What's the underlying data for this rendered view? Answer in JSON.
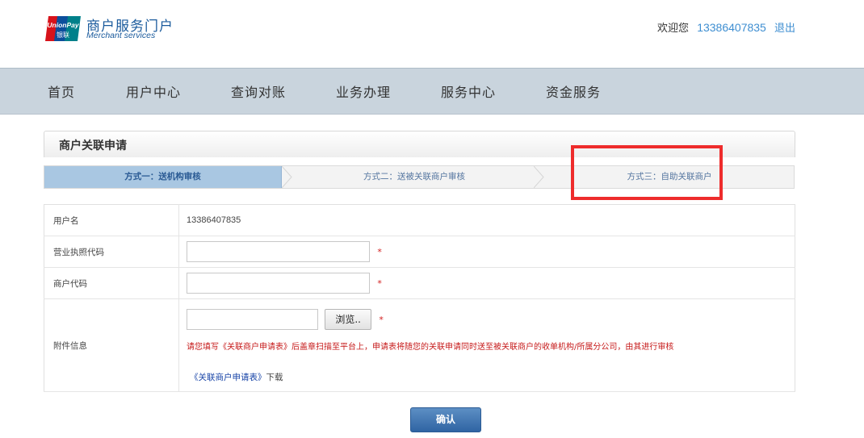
{
  "header": {
    "logo_brand_en": "UnionPay",
    "logo_brand_cn": "银联",
    "logo_title": "商户服务门户",
    "logo_subtitle": "Merchant services",
    "welcome_text": "欢迎您",
    "user_phone": "13386407835",
    "logout_label": "退出"
  },
  "nav": {
    "items": [
      {
        "label": "首页"
      },
      {
        "label": "用户中心"
      },
      {
        "label": "查询对账"
      },
      {
        "label": "业务办理"
      },
      {
        "label": "服务中心"
      },
      {
        "label": "资金服务"
      }
    ]
  },
  "panel": {
    "title": "商户关联申请",
    "steps": [
      {
        "label": "方式一：送机构审核",
        "active": true
      },
      {
        "label": "方式二：送被关联商户审核",
        "active": false
      },
      {
        "label": "方式三：自助关联商户",
        "active": false
      }
    ]
  },
  "form": {
    "username_label": "用户名",
    "username_value": "13386407835",
    "license_label": "营业执照代码",
    "license_value": "",
    "merchant_code_label": "商户代码",
    "merchant_code_value": "",
    "attachment_label": "附件信息",
    "attachment_value": "",
    "browse_label": "浏览..",
    "required_mark": "*",
    "notice": "请您填写《关联商户申请表》后盖章扫描至平台上，申请表将随您的关联申请同时送至被关联商户的收单机构/所属分公司，由其进行审核",
    "download_link": "《关联商户申请表》",
    "download_suffix": "下载"
  },
  "confirm_label": "确认",
  "colors": {
    "nav_bg": "#c9d4dd",
    "accent_blue": "#3e8ed1",
    "active_step_bg": "#a9c7e2",
    "highlight_red": "#ee2c2c",
    "button_blue": "#2f64a3"
  }
}
